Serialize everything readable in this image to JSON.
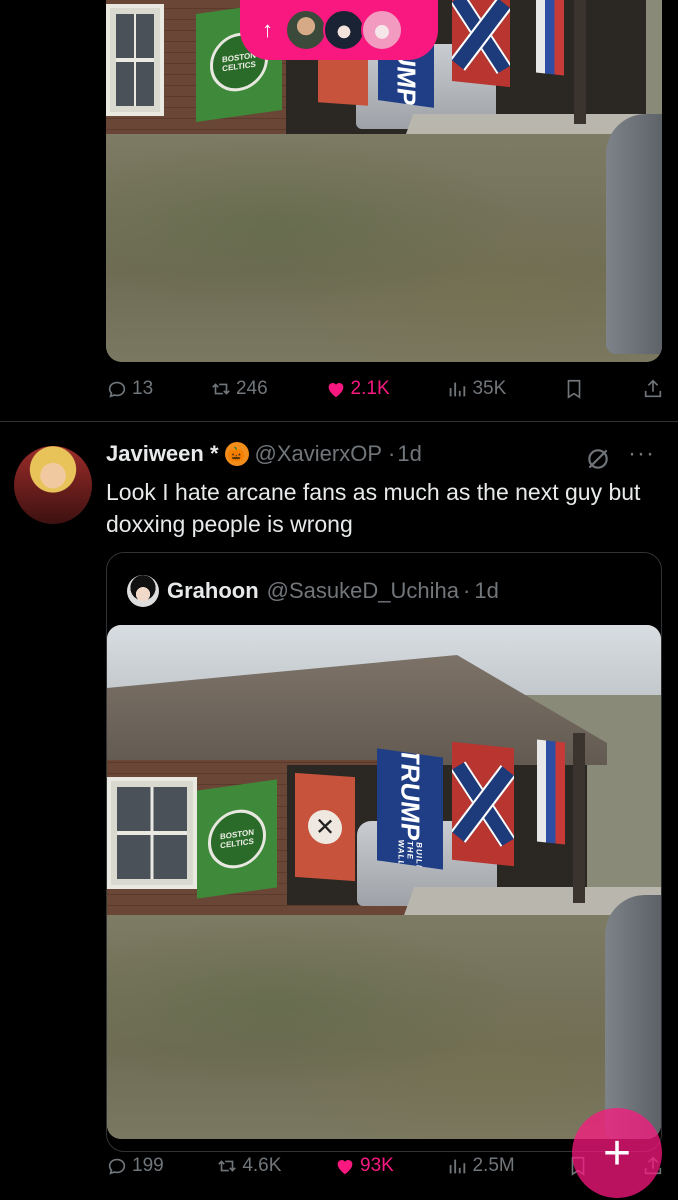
{
  "new_posts_pill": {
    "arrow": "↑",
    "avatars": [
      "avatar-man",
      "avatar-anime-dark",
      "avatar-anime-pink"
    ]
  },
  "top_post": {
    "flag_texts": {
      "green_seal": "BOSTON CELTICS",
      "blue": "TRUMP",
      "blue_sub": "BUILD THE WALL"
    },
    "actions": {
      "replies": "13",
      "reposts": "246",
      "likes": "2.1K",
      "views": "35K"
    }
  },
  "tweet": {
    "display_name": "Javiween *",
    "emoji": "🎃",
    "handle": "@XavierxOP",
    "separator": "·",
    "time": "1d",
    "text": "Look I hate arcane fans as much as the next guy but doxxing people is wrong",
    "more": "···",
    "quote": {
      "display_name": "Grahoon",
      "handle": "@SasukeD_Uchiha",
      "separator": "·",
      "time": "1d",
      "flag_texts": {
        "green_seal": "BOSTON CELTICS",
        "blue": "TRUMP",
        "blue_sub": "BUILD THE WALL"
      }
    },
    "actions": {
      "replies": "199",
      "reposts": "4.6K",
      "likes": "93K",
      "views": "2.5M"
    }
  },
  "fab": {
    "label": "+"
  },
  "colors": {
    "accent": "#f91880",
    "muted": "#71767b",
    "text": "#e7e9ea",
    "background": "#000000",
    "divider": "#2f3336"
  },
  "icons": [
    "arrow-up-icon",
    "reply-icon",
    "repost-icon",
    "like-icon",
    "views-icon",
    "bookmark-icon",
    "share-icon",
    "grok-icon",
    "more-icon",
    "plus-icon"
  ]
}
